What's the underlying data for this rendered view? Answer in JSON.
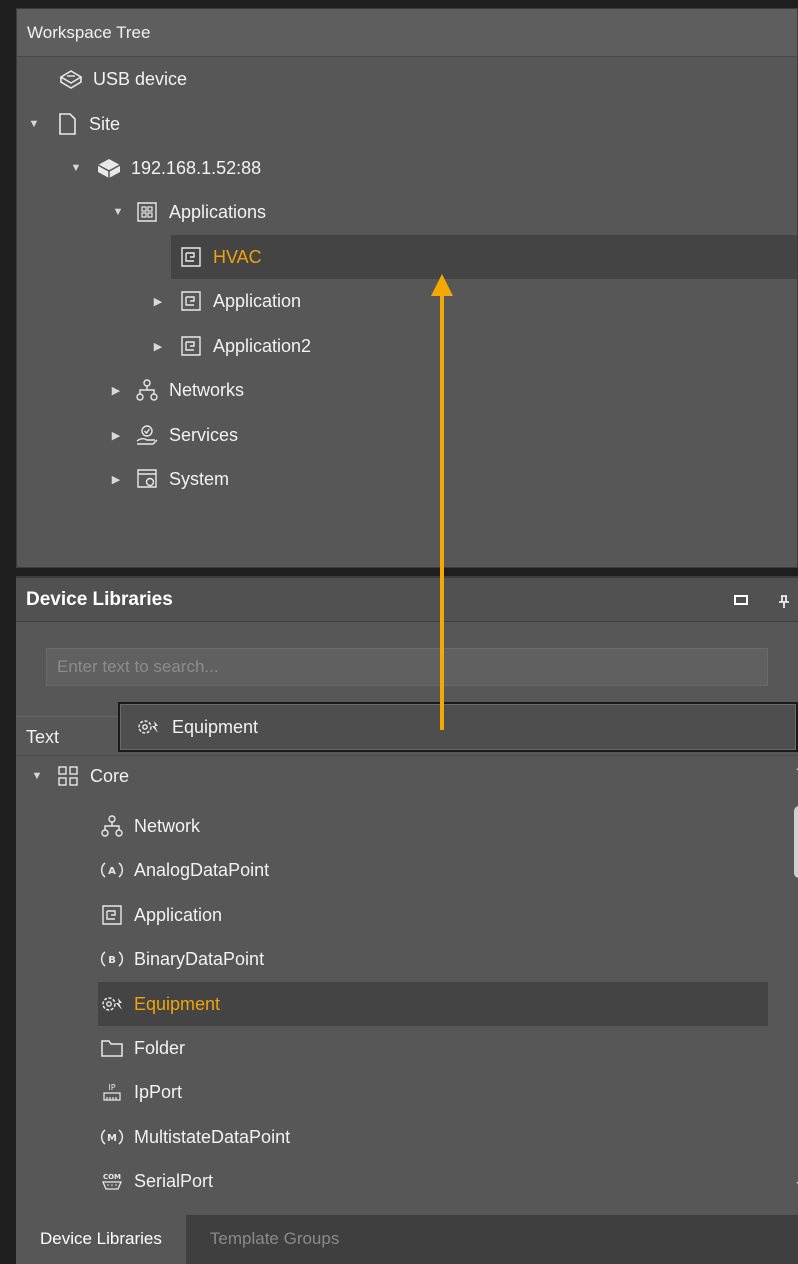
{
  "workspace": {
    "title": "Workspace Tree",
    "items": [
      {
        "label": "USB device",
        "icon": "usb-device-icon"
      },
      {
        "label": "Site",
        "icon": "document-icon",
        "expanded": true
      },
      {
        "label": "192.168.1.52:88",
        "icon": "device-icon",
        "expanded": true
      },
      {
        "label": "Applications",
        "icon": "applications-icon",
        "expanded": true
      },
      {
        "label": "HVAC",
        "icon": "application-icon",
        "selected": true
      },
      {
        "label": "Application",
        "icon": "application-icon",
        "expanded": false
      },
      {
        "label": "Application2",
        "icon": "application-icon",
        "expanded": false
      },
      {
        "label": "Networks",
        "icon": "network-icon",
        "expanded": false
      },
      {
        "label": "Services",
        "icon": "services-icon",
        "expanded": false
      },
      {
        "label": "System",
        "icon": "system-icon",
        "expanded": false
      }
    ]
  },
  "device_libraries": {
    "title": "Device Libraries",
    "search_placeholder": "Enter text to search...",
    "column_header": "Text",
    "drag_item": {
      "label": "Equipment",
      "icon": "equipment-icon"
    },
    "items": [
      {
        "label": "Core",
        "icon": "core-grid-icon",
        "expanded": true
      },
      {
        "label": "Network",
        "icon": "network-icon"
      },
      {
        "label": "AnalogDataPoint",
        "icon": "analog-datapoint-icon"
      },
      {
        "label": "Application",
        "icon": "application-icon"
      },
      {
        "label": "BinaryDataPoint",
        "icon": "binary-datapoint-icon"
      },
      {
        "label": "Equipment",
        "icon": "equipment-icon",
        "selected": true
      },
      {
        "label": "Folder",
        "icon": "folder-icon"
      },
      {
        "label": "IpPort",
        "icon": "ip-port-icon"
      },
      {
        "label": "MultistateDataPoint",
        "icon": "multistate-datapoint-icon"
      },
      {
        "label": "SerialPort",
        "icon": "serial-port-icon"
      }
    ]
  },
  "tabs": [
    "Device Libraries",
    "Template Groups"
  ],
  "colors": {
    "accent": "#f0a30a",
    "panel": "#575757",
    "selection": "#444444",
    "drag_arrow": "#f5a800"
  }
}
